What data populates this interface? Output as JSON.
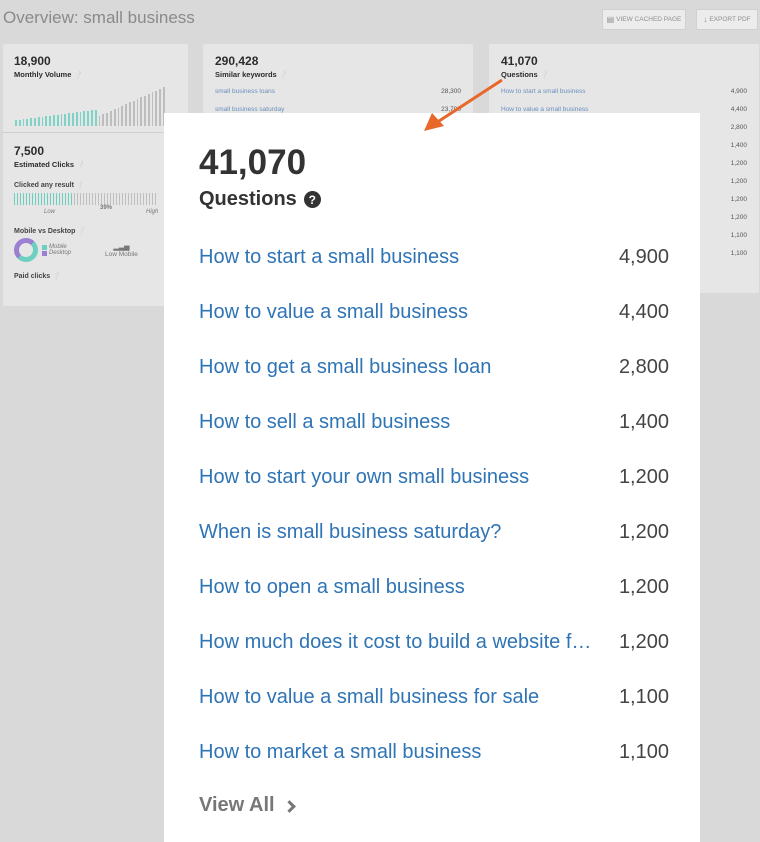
{
  "page": {
    "title": "Overview: small business",
    "buttons": {
      "cached": "VIEW CACHED PAGE",
      "export": "EXPORT PDF"
    }
  },
  "cards": {
    "volume": {
      "value": "18,900",
      "label": "Monthly Volume"
    },
    "clicks": {
      "value": "7,500",
      "label": "Estimated Clicks",
      "clicked_any": "Clicked any result",
      "pct": "39%",
      "low": "Low",
      "high": "High",
      "mobile_desktop": "Mobile vs Desktop",
      "legend_mobile": "Mobile",
      "legend_desktop": "Desktop",
      "low_mobile": "Low Mobile",
      "paid": "Paid clicks"
    },
    "similar": {
      "value": "290,428",
      "label": "Similar keywords",
      "rows": [
        {
          "k": "small business loans",
          "v": "28,300"
        },
        {
          "k": "small business saturday",
          "v": "23,700"
        }
      ]
    },
    "questions_small": {
      "value": "41,070",
      "label": "Questions",
      "rows": [
        {
          "k": "How to start a small business",
          "v": "4,900"
        },
        {
          "k": "How to value a small business",
          "v": "4,400"
        },
        {
          "k": "",
          "v": "2,800"
        },
        {
          "k": "",
          "v": "1,400"
        },
        {
          "k": "",
          "v": "1,200"
        },
        {
          "k": "",
          "v": "1,200"
        },
        {
          "k": "",
          "v": "1,200"
        },
        {
          "k": "",
          "v": "1,200"
        },
        {
          "k": "",
          "v": "1,100"
        },
        {
          "k": "",
          "v": "1,100"
        }
      ]
    }
  },
  "popup": {
    "count": "41,070",
    "label": "Questions",
    "help_glyph": "?",
    "questions": [
      {
        "text": "How to start a small business",
        "value": "4,900"
      },
      {
        "text": "How to value a small business",
        "value": "4,400"
      },
      {
        "text": "How to get a small business loan",
        "value": "2,800"
      },
      {
        "text": "How to sell a small business",
        "value": "1,400"
      },
      {
        "text": "How to start your own small business",
        "value": "1,200"
      },
      {
        "text": "When is small business saturday?",
        "value": "1,200"
      },
      {
        "text": "How to open a small business",
        "value": "1,200"
      },
      {
        "text": "How much does it cost to build a website for a small business",
        "value": "1,200"
      },
      {
        "text": "How to value a small business for sale",
        "value": "1,100"
      },
      {
        "text": "How to market a small business",
        "value": "1,100"
      }
    ],
    "view_all": "View All"
  },
  "colors": {
    "link": "#2f74b5",
    "arrow": "#e8672a",
    "teal": "#6ccfbf",
    "purple": "#9b7fd0"
  }
}
